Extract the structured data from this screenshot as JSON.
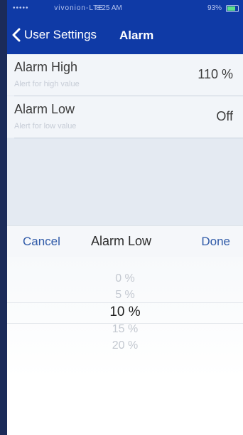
{
  "status_bar": {
    "signal": "•••••",
    "carrier": "vivonion-LTE",
    "time": "8:25 AM",
    "battery": "93%"
  },
  "nav": {
    "back_label": "User Settings",
    "title": "Alarm"
  },
  "settings": {
    "rows": [
      {
        "title": "Alarm High",
        "subtitle": "Alert for high value",
        "value": "110 %"
      },
      {
        "title": "Alarm Low",
        "subtitle": "Alert for low value",
        "value": "Off"
      }
    ]
  },
  "picker": {
    "cancel_label": "Cancel",
    "title": "Alarm Low",
    "done_label": "Done",
    "options": [
      "0 %",
      "5 %",
      "10 %",
      "15 %",
      "20 %"
    ],
    "selected": "10 %"
  },
  "colors": {
    "nav_blue": "#0f3aa6",
    "link_blue": "#2f5aa8"
  },
  "icons": {
    "back": "chevron-left-icon",
    "battery": "battery-icon"
  }
}
